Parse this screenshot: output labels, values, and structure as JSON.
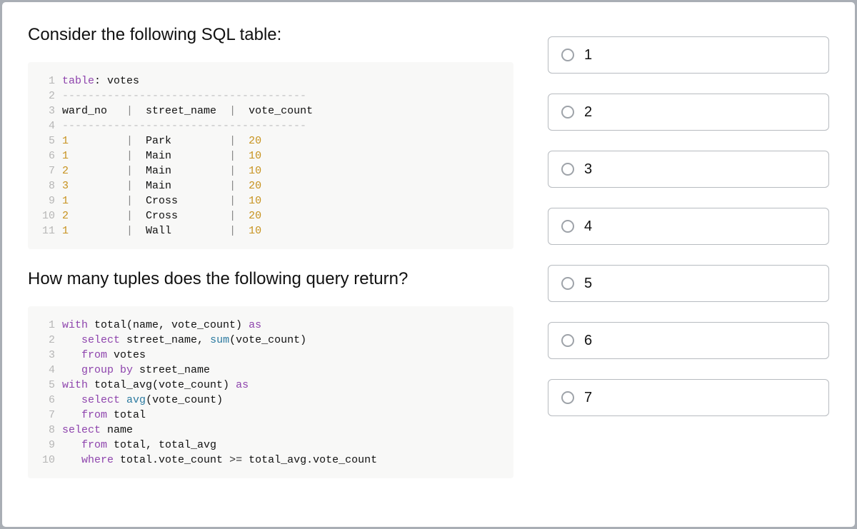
{
  "prompt1": "Consider the following SQL table:",
  "prompt2": "How many tuples does the following query return?",
  "code1": [
    {
      "n": "1",
      "tokens": [
        {
          "t": "table",
          "c": "kw"
        },
        {
          "t": ": votes",
          "c": "str"
        }
      ]
    },
    {
      "n": "2",
      "tokens": [
        {
          "t": "--------------------------------------",
          "c": "dash"
        }
      ]
    },
    {
      "n": "3",
      "tokens": [
        {
          "t": "ward_no   ",
          "c": "str"
        },
        {
          "t": "|",
          "c": "pipe"
        },
        {
          "t": "  street_name  ",
          "c": "str"
        },
        {
          "t": "|",
          "c": "pipe"
        },
        {
          "t": "  vote_count",
          "c": "str"
        }
      ]
    },
    {
      "n": "4",
      "tokens": [
        {
          "t": "--------------------------------------",
          "c": "dash"
        }
      ]
    },
    {
      "n": "5",
      "tokens": [
        {
          "t": "1",
          "c": "num"
        },
        {
          "t": "         ",
          "c": "str"
        },
        {
          "t": "|",
          "c": "pipe"
        },
        {
          "t": "  Park         ",
          "c": "str"
        },
        {
          "t": "|",
          "c": "pipe"
        },
        {
          "t": "  ",
          "c": "str"
        },
        {
          "t": "20",
          "c": "num"
        }
      ]
    },
    {
      "n": "6",
      "tokens": [
        {
          "t": "1",
          "c": "num"
        },
        {
          "t": "         ",
          "c": "str"
        },
        {
          "t": "|",
          "c": "pipe"
        },
        {
          "t": "  Main         ",
          "c": "str"
        },
        {
          "t": "|",
          "c": "pipe"
        },
        {
          "t": "  ",
          "c": "str"
        },
        {
          "t": "10",
          "c": "num"
        }
      ]
    },
    {
      "n": "7",
      "tokens": [
        {
          "t": "2",
          "c": "num"
        },
        {
          "t": "         ",
          "c": "str"
        },
        {
          "t": "|",
          "c": "pipe"
        },
        {
          "t": "  Main         ",
          "c": "str"
        },
        {
          "t": "|",
          "c": "pipe"
        },
        {
          "t": "  ",
          "c": "str"
        },
        {
          "t": "10",
          "c": "num"
        }
      ]
    },
    {
      "n": "8",
      "tokens": [
        {
          "t": "3",
          "c": "num"
        },
        {
          "t": "         ",
          "c": "str"
        },
        {
          "t": "|",
          "c": "pipe"
        },
        {
          "t": "  Main         ",
          "c": "str"
        },
        {
          "t": "|",
          "c": "pipe"
        },
        {
          "t": "  ",
          "c": "str"
        },
        {
          "t": "20",
          "c": "num"
        }
      ]
    },
    {
      "n": "9",
      "tokens": [
        {
          "t": "1",
          "c": "num"
        },
        {
          "t": "         ",
          "c": "str"
        },
        {
          "t": "|",
          "c": "pipe"
        },
        {
          "t": "  Cross        ",
          "c": "str"
        },
        {
          "t": "|",
          "c": "pipe"
        },
        {
          "t": "  ",
          "c": "str"
        },
        {
          "t": "10",
          "c": "num"
        }
      ]
    },
    {
      "n": "10",
      "tokens": [
        {
          "t": "2",
          "c": "num"
        },
        {
          "t": "         ",
          "c": "str"
        },
        {
          "t": "|",
          "c": "pipe"
        },
        {
          "t": "  Cross        ",
          "c": "str"
        },
        {
          "t": "|",
          "c": "pipe"
        },
        {
          "t": "  ",
          "c": "str"
        },
        {
          "t": "20",
          "c": "num"
        }
      ]
    },
    {
      "n": "11",
      "tokens": [
        {
          "t": "1",
          "c": "num"
        },
        {
          "t": "         ",
          "c": "str"
        },
        {
          "t": "|",
          "c": "pipe"
        },
        {
          "t": "  Wall         ",
          "c": "str"
        },
        {
          "t": "|",
          "c": "pipe"
        },
        {
          "t": "  ",
          "c": "str"
        },
        {
          "t": "10",
          "c": "num"
        }
      ]
    }
  ],
  "code2": [
    {
      "n": "1",
      "tokens": [
        {
          "t": "with",
          "c": "kw"
        },
        {
          "t": " total(name, vote_count) ",
          "c": "str"
        },
        {
          "t": "as",
          "c": "kw"
        }
      ]
    },
    {
      "n": "2",
      "tokens": [
        {
          "t": "   ",
          "c": "str"
        },
        {
          "t": "select",
          "c": "kw"
        },
        {
          "t": " street_name, ",
          "c": "str"
        },
        {
          "t": "sum",
          "c": "func"
        },
        {
          "t": "(vote_count)",
          "c": "str"
        }
      ]
    },
    {
      "n": "3",
      "tokens": [
        {
          "t": "   ",
          "c": "str"
        },
        {
          "t": "from",
          "c": "kw"
        },
        {
          "t": " votes",
          "c": "str"
        }
      ]
    },
    {
      "n": "4",
      "tokens": [
        {
          "t": "   ",
          "c": "str"
        },
        {
          "t": "group by",
          "c": "kw"
        },
        {
          "t": " street_name",
          "c": "str"
        }
      ]
    },
    {
      "n": "5",
      "tokens": [
        {
          "t": "with",
          "c": "kw"
        },
        {
          "t": " total_avg(vote_count) ",
          "c": "str"
        },
        {
          "t": "as",
          "c": "kw"
        }
      ]
    },
    {
      "n": "6",
      "tokens": [
        {
          "t": "   ",
          "c": "str"
        },
        {
          "t": "select",
          "c": "kw"
        },
        {
          "t": " ",
          "c": "str"
        },
        {
          "t": "avg",
          "c": "func"
        },
        {
          "t": "(vote_count)",
          "c": "str"
        }
      ]
    },
    {
      "n": "7",
      "tokens": [
        {
          "t": "   ",
          "c": "str"
        },
        {
          "t": "from",
          "c": "kw"
        },
        {
          "t": " total",
          "c": "str"
        }
      ]
    },
    {
      "n": "8",
      "tokens": [
        {
          "t": "select",
          "c": "kw"
        },
        {
          "t": " name",
          "c": "str"
        }
      ]
    },
    {
      "n": "9",
      "tokens": [
        {
          "t": "   ",
          "c": "str"
        },
        {
          "t": "from",
          "c": "kw"
        },
        {
          "t": " total, total_avg",
          "c": "str"
        }
      ]
    },
    {
      "n": "10",
      "tokens": [
        {
          "t": "   ",
          "c": "str"
        },
        {
          "t": "where",
          "c": "kw"
        },
        {
          "t": " total.vote_count ",
          "c": "str"
        },
        {
          "t": ">=",
          "c": "op"
        },
        {
          "t": " total_avg.vote_count",
          "c": "str"
        }
      ]
    }
  ],
  "options": [
    "1",
    "2",
    "3",
    "4",
    "5",
    "6",
    "7"
  ]
}
